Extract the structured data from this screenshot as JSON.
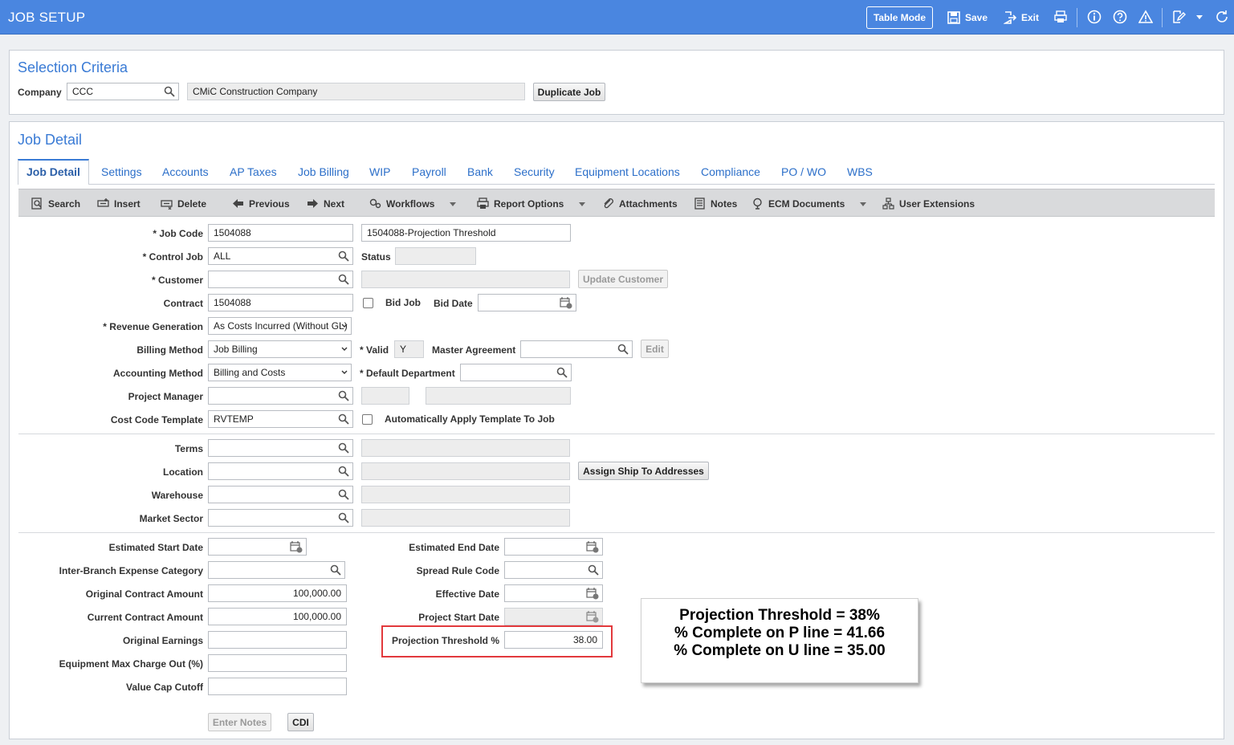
{
  "app": {
    "title": "JOB SETUP"
  },
  "topbar": {
    "table_mode": "Table Mode",
    "save": "Save",
    "exit": "Exit"
  },
  "selection": {
    "title": "Selection Criteria",
    "company_label": "Company",
    "company_value": "CCC",
    "company_name": "CMiC Construction Company",
    "duplicate_button": "Duplicate Job"
  },
  "job_detail": {
    "title": "Job Detail"
  },
  "tabs": [
    "Job Detail",
    "Settings",
    "Accounts",
    "AP Taxes",
    "Job Billing",
    "WIP",
    "Payroll",
    "Bank",
    "Security",
    "Equipment Locations",
    "Compliance",
    "PO / WO",
    "WBS"
  ],
  "toolbar": {
    "search": "Search",
    "insert": "Insert",
    "delete": "Delete",
    "previous": "Previous",
    "next": "Next",
    "workflows": "Workflows",
    "report_options": "Report Options",
    "attachments": "Attachments",
    "notes": "Notes",
    "ecm_documents": "ECM Documents",
    "user_extensions": "User Extensions"
  },
  "form": {
    "job_code_label": "Job Code",
    "job_code": "1504088",
    "job_name": "1504088-Projection Threshold",
    "control_job_label": "Control Job",
    "control_job": "ALL",
    "status_label": "Status",
    "status": "",
    "customer_label": "Customer",
    "customer": "",
    "customer_name": "",
    "update_customer": "Update Customer",
    "contract_label": "Contract",
    "contract": "1504088",
    "bid_job_label": "Bid Job",
    "bid_date_label": "Bid Date",
    "bid_date": "",
    "revenue_generation_label": "Revenue Generation",
    "revenue_generation": "As Costs Incurred (Without GL)",
    "billing_method_label": "Billing Method",
    "billing_method": "Job Billing",
    "valid_label": "Valid",
    "valid": "Y",
    "master_agreement_label": "Master Agreement",
    "master_agreement": "",
    "edit": "Edit",
    "accounting_method_label": "Accounting Method",
    "accounting_method": "Billing and Costs",
    "default_department_label": "Default Department",
    "default_department": "",
    "project_manager_label": "Project Manager",
    "project_manager": "",
    "cost_code_template_label": "Cost Code Template",
    "cost_code_template": "RVTEMP",
    "auto_apply_label": "Automatically Apply Template To Job",
    "terms_label": "Terms",
    "terms": "",
    "location_label": "Location",
    "location": "",
    "assign_ship": "Assign Ship To Addresses",
    "warehouse_label": "Warehouse",
    "warehouse": "",
    "market_sector_label": "Market Sector",
    "market_sector": "",
    "est_start_label": "Estimated Start Date",
    "est_start": "",
    "est_end_label": "Estimated End Date",
    "est_end": "",
    "inter_branch_label": "Inter-Branch Expense Category",
    "inter_branch": "",
    "spread_rule_label": "Spread Rule Code",
    "spread_rule": "",
    "orig_contract_label": "Original Contract Amount",
    "orig_contract": "100,000.00",
    "effective_date_label": "Effective Date",
    "effective_date": "",
    "curr_contract_label": "Current Contract Amount",
    "curr_contract": "100,000.00",
    "project_start_label": "Project Start Date",
    "project_start": "",
    "orig_earnings_label": "Original Earnings",
    "orig_earnings": "",
    "proj_threshold_label": "Projection Threshold %",
    "proj_threshold": "38.00",
    "equip_max_label": "Equipment Max Charge Out (%)",
    "equip_max": "",
    "value_cap_label": "Value Cap Cutoff",
    "value_cap": "",
    "enter_notes": "Enter Notes",
    "cdi": "CDI"
  },
  "callout": {
    "line1": "Projection Threshold = 38%",
    "line2": "% Complete on P line = 41.66",
    "line3": "% Complete on U line = 35.00"
  },
  "colors": {
    "accent": "#4a86e0",
    "highlight": "#e2393c"
  }
}
